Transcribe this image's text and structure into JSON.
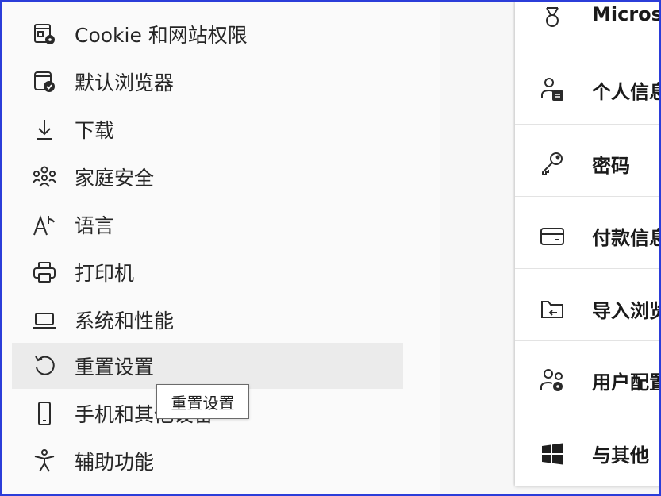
{
  "sidebar": {
    "items": [
      {
        "label": "Cookie 和网站权限",
        "icon": "cookie-site-permissions-icon"
      },
      {
        "label": "默认浏览器",
        "icon": "default-browser-icon"
      },
      {
        "label": "下载",
        "icon": "download-icon"
      },
      {
        "label": "家庭安全",
        "icon": "family-safety-icon"
      },
      {
        "label": "语言",
        "icon": "language-icon"
      },
      {
        "label": "打印机",
        "icon": "printer-icon"
      },
      {
        "label": "系统和性能",
        "icon": "laptop-icon"
      },
      {
        "label": "重置设置",
        "icon": "reset-icon",
        "hovered": true
      },
      {
        "label": "手机和其他设备",
        "icon": "phone-icon"
      },
      {
        "label": "辅助功能",
        "icon": "accessibility-icon"
      }
    ]
  },
  "tooltip": {
    "text": "重置设置"
  },
  "profile_card": {
    "items": [
      {
        "label": "Micros",
        "icon": "rewards-medal-icon"
      },
      {
        "label": "个人信息",
        "icon": "personal-info-icon"
      },
      {
        "label": "密码",
        "icon": "key-icon"
      },
      {
        "label": "付款信息",
        "icon": "credit-card-icon"
      },
      {
        "label": "导入浏览器数据",
        "icon": "import-folder-icon"
      },
      {
        "label": "用户配置文件偏好设置",
        "icon": "profile-settings-icon"
      },
      {
        "label": "与其他",
        "icon": "windows-icon"
      }
    ]
  },
  "colors": {
    "accent_border": "#2b3dd9",
    "hover_bg": "#ebebeb"
  }
}
